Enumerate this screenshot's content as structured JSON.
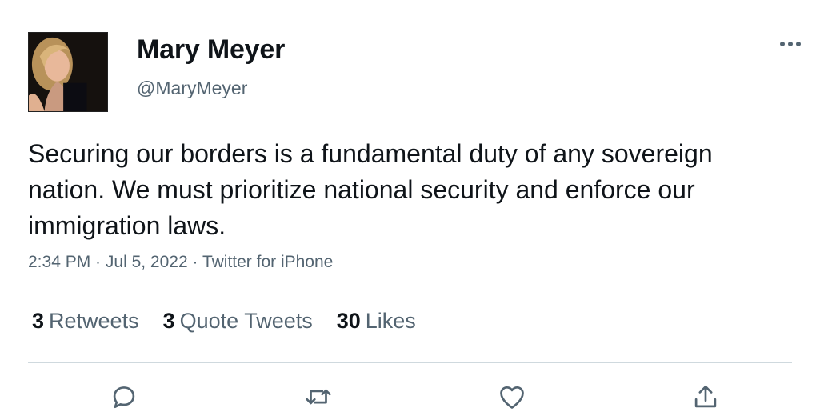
{
  "author": {
    "name": "Mary Meyer",
    "handle": "@MaryMeyer",
    "avatar_icon": "profile-photo"
  },
  "tweet": {
    "text": "Securing our borders is a fundamental duty of any sovereign nation. We must prioritize national security and enforce our immigration laws.",
    "time": "2:34 PM",
    "date": "Jul 5, 2022",
    "source": "Twitter for iPhone",
    "separator": " · "
  },
  "stats": {
    "retweets_count": "3",
    "retweets_label": "Retweets",
    "quotes_count": "3",
    "quotes_label": "Quote Tweets",
    "likes_count": "30",
    "likes_label": "Likes"
  },
  "icons": {
    "more": "more-dots-icon",
    "reply": "reply-icon",
    "retweet": "retweet-icon",
    "like": "heart-icon",
    "share": "share-icon"
  },
  "colors": {
    "text_primary": "#0f1419",
    "text_secondary": "#536471",
    "divider": "#cfd9de"
  }
}
